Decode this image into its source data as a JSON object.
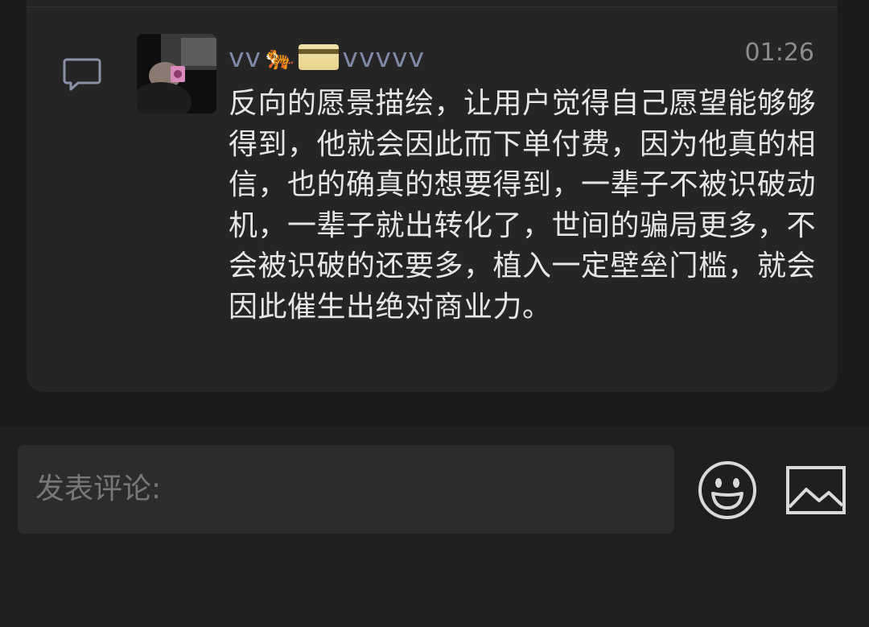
{
  "post": {
    "username_prefix": "vv",
    "username_tiger": "🐅",
    "username_suffix": "vvvvv",
    "time": "01:26",
    "message": "反向的愿景描绘，让用户觉得自己愿望能够够得到，他就会因此而下单付费，因为他真的相信，也的确真的想要得到，一辈子不被识破动机，一辈子就出转化了，世间的骗局更多，不会被识破的还要多，植入一定壁垒门槛，就会因此催生出绝对商业力。"
  },
  "composer": {
    "placeholder": "发表评论:",
    "value": ""
  },
  "icons": {
    "comment": "comment-icon",
    "emoji": "smiley-icon",
    "image": "image-icon"
  },
  "colors": {
    "background": "#1b1b1b",
    "card": "#252525",
    "username": "#7e8aa8",
    "message_text": "#e6e6e6",
    "time": "#8c8c8c",
    "input_bg": "#2c2c2c",
    "icon": "#d9d9d9"
  }
}
